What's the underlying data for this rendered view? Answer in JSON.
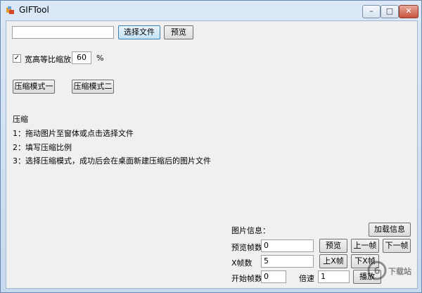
{
  "window": {
    "title": "GIFTool",
    "minimize": "–",
    "maximize": "□",
    "close": "✕"
  },
  "file": {
    "path_value": "",
    "select_file_label": "选择文件",
    "preview_label": "预览"
  },
  "scale": {
    "checkbox_checked": true,
    "checkbox_label": "宽高等比缩放",
    "value": "60",
    "unit": "%"
  },
  "modes": {
    "mode1_label": "压缩模式一",
    "mode2_label": "压缩模式二"
  },
  "instructions": {
    "heading": "压缩",
    "line1": "1：拖动图片至窗体或点击选择文件",
    "line2": "2：填写压缩比例",
    "line3": "3：选择压缩模式，成功后会在桌面新建压缩后的图片文件"
  },
  "info": {
    "title": "图片信息：",
    "load_label": "加载信息",
    "preview_frames_label": "预览帧数",
    "preview_frames_value": "0",
    "preview_button": "预览",
    "prev_frame": "上一帧",
    "next_frame": "下一帧",
    "x_frames_label": "X帧数",
    "x_frames_value": "5",
    "upper_frame": "上X帧",
    "lower_frame": "下X帧",
    "start_frames_label": "开始帧数",
    "start_frames_value": "0",
    "speed_label": "倍速",
    "speed_value": "1",
    "speed_button": "播放"
  },
  "watermark": {
    "text": "下载站"
  }
}
